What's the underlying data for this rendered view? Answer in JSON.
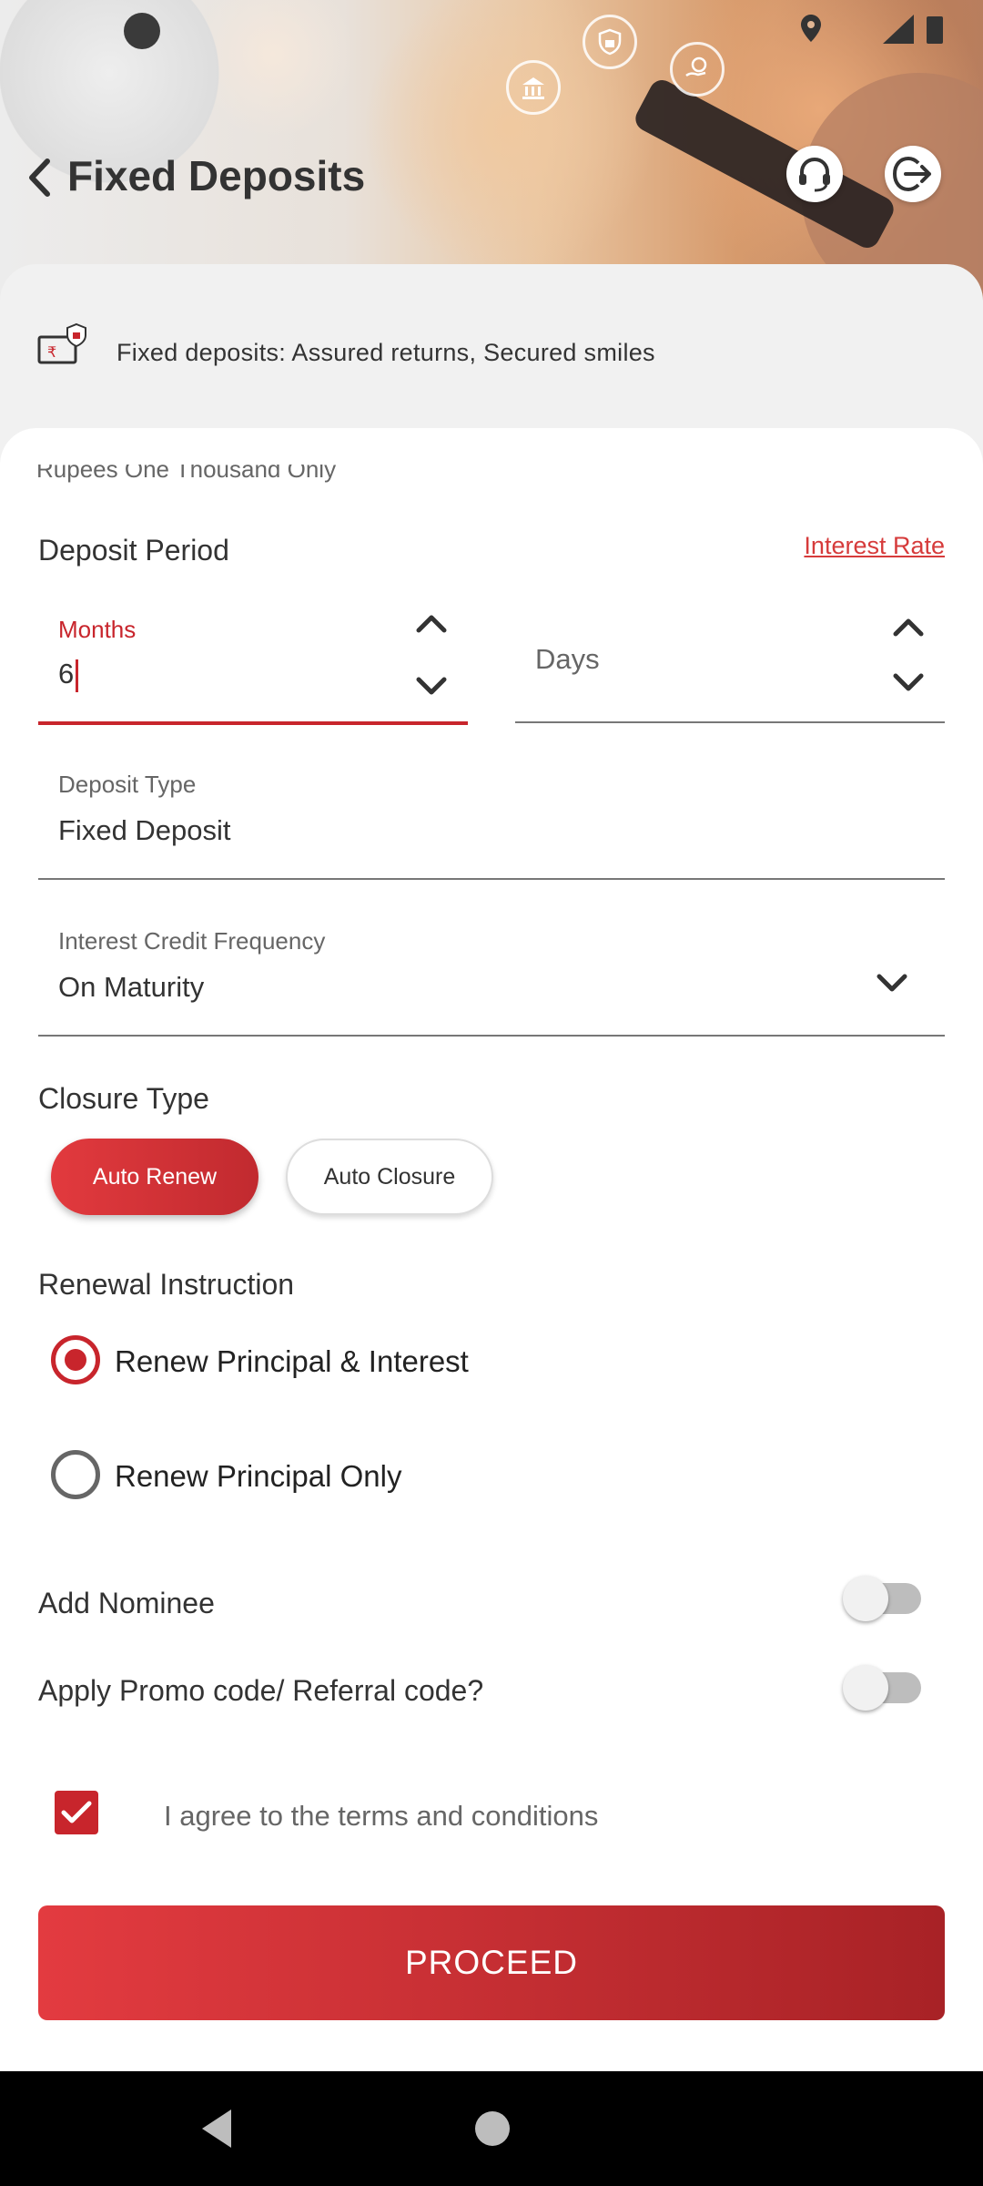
{
  "header": {
    "title": "Fixed Deposits",
    "back_icon": "back-chevron-icon",
    "support_icon": "headset-icon",
    "logout_icon": "logout-icon"
  },
  "banner": {
    "text": "Fixed deposits: Assured returns, Secured smiles",
    "icon": "secure-money-icon"
  },
  "cut_off_text": "Rupees One Thousand Only",
  "deposit_period": {
    "label": "Deposit Period",
    "interest_rate_link": "Interest Rate",
    "months": {
      "label": "Months",
      "value": "6"
    },
    "days": {
      "placeholder": "Days"
    }
  },
  "deposit_type": {
    "label": "Deposit Type",
    "value": "Fixed Deposit"
  },
  "interest_credit": {
    "label": "Interest Credit Frequency",
    "value": "On Maturity"
  },
  "closure_type": {
    "label": "Closure Type",
    "options": [
      "Auto Renew",
      "Auto Closure"
    ],
    "selected": "Auto Renew"
  },
  "renewal": {
    "label": "Renewal Instruction",
    "options": [
      "Renew Principal & Interest",
      "Renew Principal Only"
    ],
    "selected": "Renew Principal & Interest"
  },
  "toggles": {
    "nominee": "Add Nominee",
    "promo": "Apply Promo code/ Referral code?"
  },
  "terms": {
    "label": "I agree to the terms and conditions",
    "checked": true
  },
  "proceed_label": "PROCEED",
  "colors": {
    "accent": "#c8252c",
    "accent_light": "#e33b40"
  }
}
